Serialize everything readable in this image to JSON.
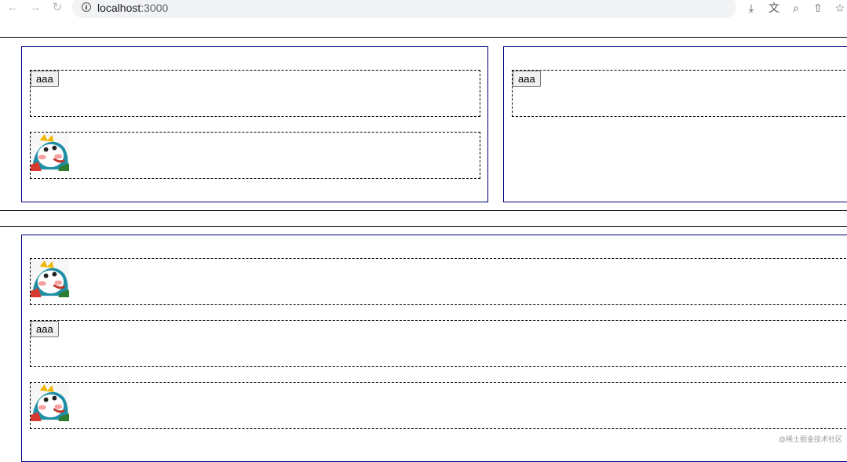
{
  "browser": {
    "url_host": "localhost",
    "url_port": ":3000",
    "icons": [
      "back-arrow-icon",
      "forward-arrow-icon",
      "reload-icon",
      "info-icon",
      "install-icon",
      "translate-icon",
      "zoom-icon",
      "share-icon",
      "star-icon"
    ]
  },
  "page": {
    "button_label": "aaa",
    "image_alt": "doraemon sticker",
    "watermark": "@稀土掘金技术社区"
  },
  "colors": {
    "block_border": "#000080",
    "slot_border": "#000000",
    "rule": "#000000"
  }
}
